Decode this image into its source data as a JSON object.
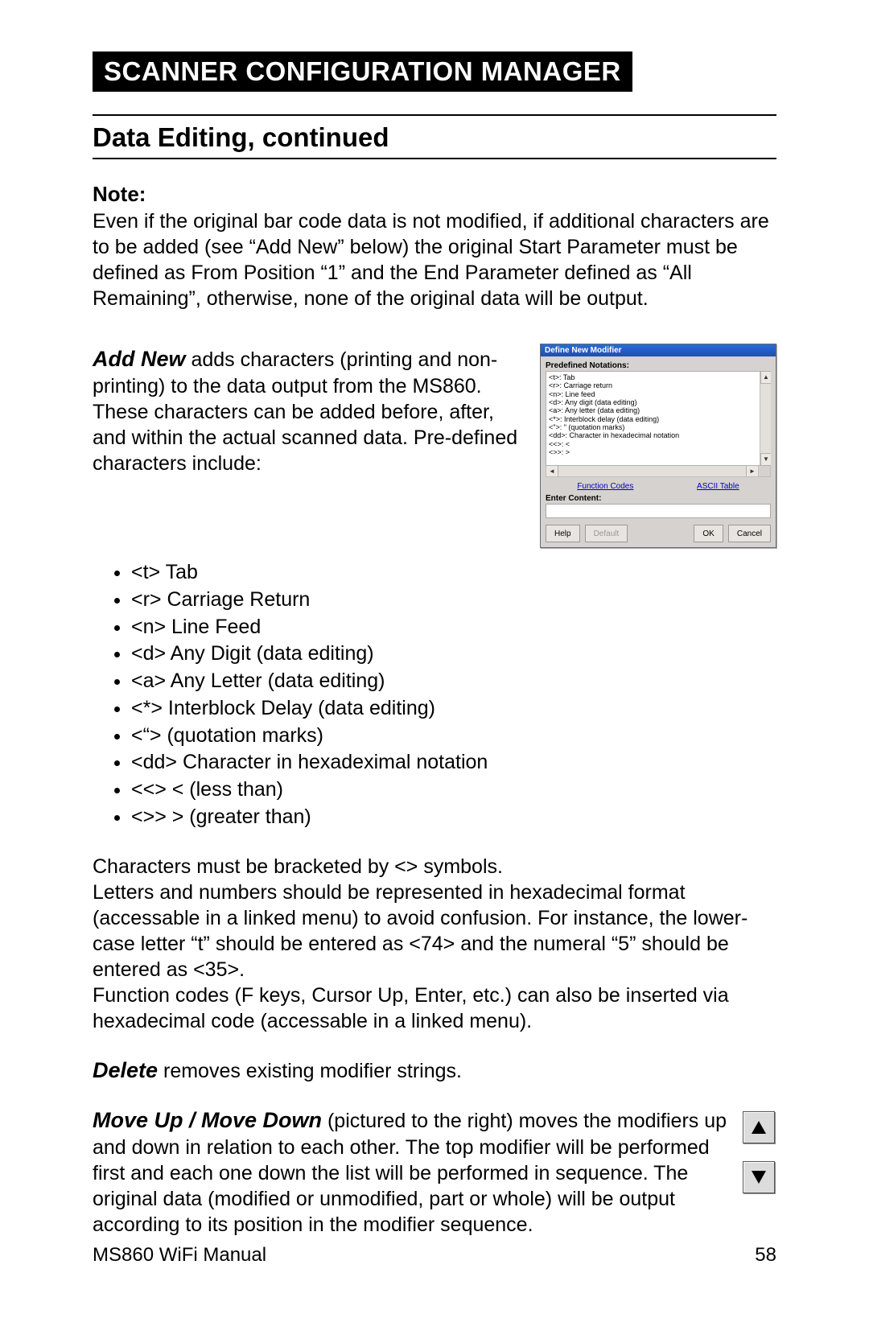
{
  "header": {
    "title": "SCANNER CONFIGURATION MANAGER",
    "section": "Data Editing, continued"
  },
  "note": {
    "label": "Note:",
    "text": "Even if the original bar code data is not modified, if additional characters are to be added (see “Add New” below) the original Start Parameter must be defined as From Position “1” and the End Parameter defined as “All Remaining”, otherwise, none of the original data will be output."
  },
  "add_new": {
    "lead": "Add New",
    "desc": " adds characters (printing and non-printing) to the data output from the MS860. These characters can be added before, after, and within the actual scanned data.  Pre-defined characters include:",
    "bullets": [
      "<t>  Tab",
      "<r>  Carriage Return",
      "<n>  Line Feed",
      "<d>  Any Digit (data editing)",
      "<a>  Any Letter (data editing)",
      "<*>  Interblock Delay (data editing)",
      "<“>  (quotation marks)",
      "<dd> Character in hexadeximal notation",
      "<<>  < (less than)",
      "<>>  > (greater than)"
    ]
  },
  "chars_para1": "Characters must be bracketed by <> symbols.",
  "chars_para2": "Letters and numbers should be represented in hexadecimal format (accessable in a linked menu) to avoid confusion.  For instance, the lower-case letter “t” should be entered as <74> and the numeral “5” should be entered as <35>.",
  "chars_para3": "Function codes (F keys, Cursor Up, Enter, etc.) can also be inserted via hexadecimal code (accessable in a linked menu).",
  "delete": {
    "lead": "Delete",
    "desc": " removes existing modifier strings."
  },
  "move": {
    "lead": "Move Up / Move Down",
    "desc": " (pictured to the right) moves the modifiers up and down in relation to each other.  The top modifier will be performed first and each one down the list will be performed in sequence.  The original data (modified or unmodified, part or whole) will be output according to its position in the modifier sequence."
  },
  "footer": {
    "left": "MS860 WiFi Manual",
    "right": "58"
  },
  "dialog": {
    "title": "Define New Modifier",
    "predef_label": "Predefined Notations:",
    "notations": [
      "<t>:  Tab",
      "<r>:  Carriage return",
      "<n>:  Line feed",
      "<d>:  Any digit (data editing)",
      "<a>:  Any letter (data editing)",
      "<*>:  Interblock delay (data editing)",
      "<\">:  \" (quotation marks)",
      "<dd>:  Character in hexadecimal notation",
      "<<>:  <",
      "<>>:  >"
    ],
    "link_func": "Function Codes",
    "link_ascii": "ASCII Table",
    "enter_label": "Enter Content:",
    "btn_help": "Help",
    "btn_default": "Default",
    "btn_ok": "OK",
    "btn_cancel": "Cancel"
  }
}
